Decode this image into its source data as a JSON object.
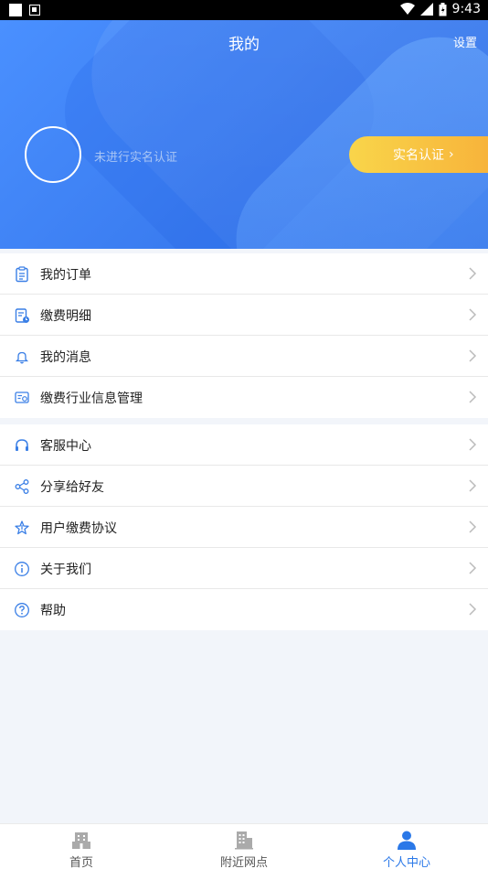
{
  "status_bar": {
    "time": "9:43"
  },
  "header": {
    "title": "我的",
    "settings_label": "设置",
    "realname_status": "未进行实名认证",
    "verify_button": "实名认证",
    "verify_chevron": "›"
  },
  "menu_group_1": [
    {
      "label": "我的订单",
      "icon": "clipboard-icon"
    },
    {
      "label": "缴费明细",
      "icon": "bill-detail-icon"
    },
    {
      "label": "我的消息",
      "icon": "bell-icon"
    },
    {
      "label": "缴费行业信息管理",
      "icon": "industry-info-icon"
    }
  ],
  "menu_group_2": [
    {
      "label": "客服中心",
      "icon": "headset-icon"
    },
    {
      "label": "分享给好友",
      "icon": "share-icon"
    },
    {
      "label": "用户缴费协议",
      "icon": "star-agreement-icon"
    },
    {
      "label": "关于我们",
      "icon": "info-icon"
    },
    {
      "label": "帮助",
      "icon": "help-icon"
    }
  ],
  "tabbar": {
    "tabs": [
      {
        "label": "首页",
        "icon": "home-building-icon",
        "active": false
      },
      {
        "label": "附近网点",
        "icon": "nearby-outlets-icon",
        "active": false
      },
      {
        "label": "个人中心",
        "icon": "person-icon",
        "active": true
      }
    ]
  },
  "colors": {
    "accent": "#2a78e8",
    "header_blue": "#3a7cf0",
    "verify_yellow": "#f7b23a"
  }
}
